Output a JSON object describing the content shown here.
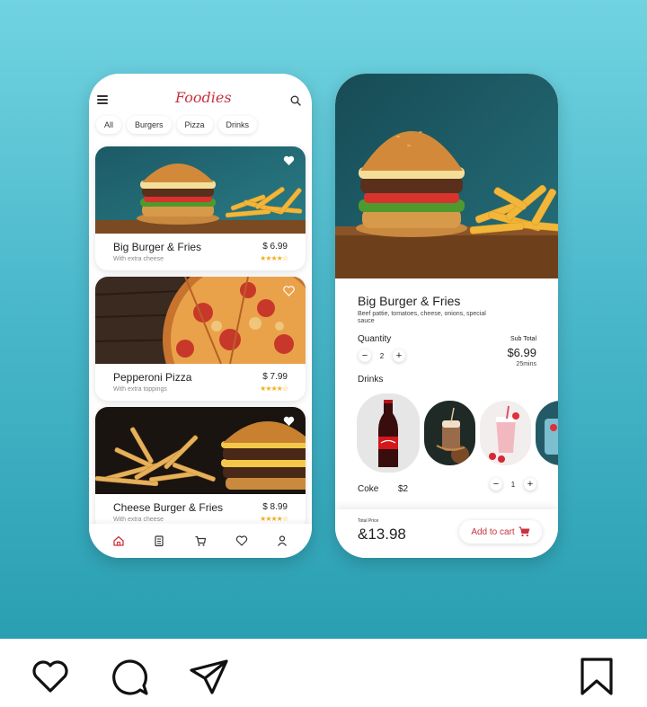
{
  "app": {
    "brand": "Foodies"
  },
  "filters": [
    "All",
    "Burgers",
    "Pizza",
    "Drinks"
  ],
  "menu": [
    {
      "name": "Big Burger & Fries",
      "sub": "With extra cheese",
      "price": "$ 6.99",
      "rating": "★★★★☆"
    },
    {
      "name": "Pepperoni Pizza",
      "sub": "With extra toppings",
      "price": "$ 7.99",
      "rating": "★★★★☆"
    },
    {
      "name": "Cheese Burger & Fries",
      "sub": "With extra cheese",
      "price": "$ 8.99",
      "rating": "★★★★☆"
    }
  ],
  "nav": [
    "home-icon",
    "orders-icon",
    "cart-icon",
    "heart-icon",
    "profile-icon"
  ],
  "detail": {
    "title": "Big Burger & Fries",
    "description": "Beef pattie, tomatoes, cheese, onions, special sauce",
    "quantity_label": "Quantity",
    "quantity": "2",
    "subtotal_label": "Sub Total",
    "subtotal": "$6.99",
    "time": "25mins",
    "drinks_label": "Drinks",
    "drink_name": "Coke",
    "drink_price": "$2",
    "drink_qty": "1",
    "total_label": "Total Price",
    "total": "&13.98",
    "cart_label": "Add to cart"
  },
  "colors": {
    "accent": "#c8323f",
    "background_top": "#71d3e0",
    "background_bottom": "#2a9fb2",
    "star": "#f2b01e"
  }
}
